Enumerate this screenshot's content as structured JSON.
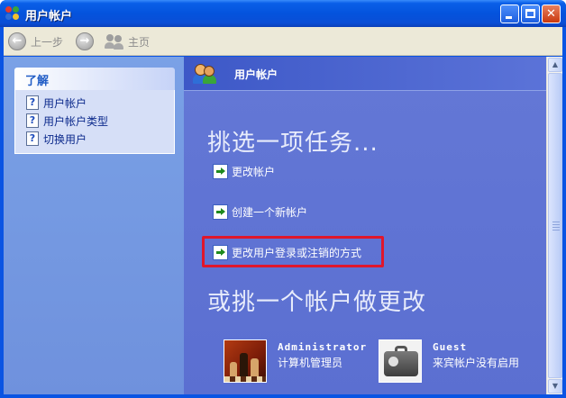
{
  "window": {
    "title": "用户帐户",
    "buttons": {
      "minimize": "minimize",
      "maximize": "maximize",
      "close": "✕"
    }
  },
  "toolbar": {
    "back_label": "上一步",
    "forward_label": "",
    "home_label": "主页"
  },
  "sidebar": {
    "section_title": "了解",
    "items": [
      {
        "label": "用户帐户"
      },
      {
        "label": "用户帐户类型"
      },
      {
        "label": "切换用户"
      }
    ]
  },
  "main": {
    "header_title": "用户帐户",
    "pick_task_heading": "挑选一项任务...",
    "tasks": [
      {
        "label": "更改帐户"
      },
      {
        "label": "创建一个新帐户"
      },
      {
        "label": "更改用户登录或注销的方式"
      }
    ],
    "pick_account_heading": "或挑一个帐户做更改",
    "accounts": [
      {
        "name": "Administrator",
        "role": "计算机管理员"
      },
      {
        "name": "Guest",
        "role": "来宾帐户没有启用"
      }
    ]
  },
  "colors": {
    "titlebar": "#0453dd",
    "left_pane": "#7aa1e6",
    "right_pane": "#6478d6",
    "highlight_border": "#e0162b"
  },
  "icons": [
    "app-icon",
    "back-icon",
    "forward-icon",
    "users-icon",
    "help-icon",
    "go-arrow-icon"
  ]
}
